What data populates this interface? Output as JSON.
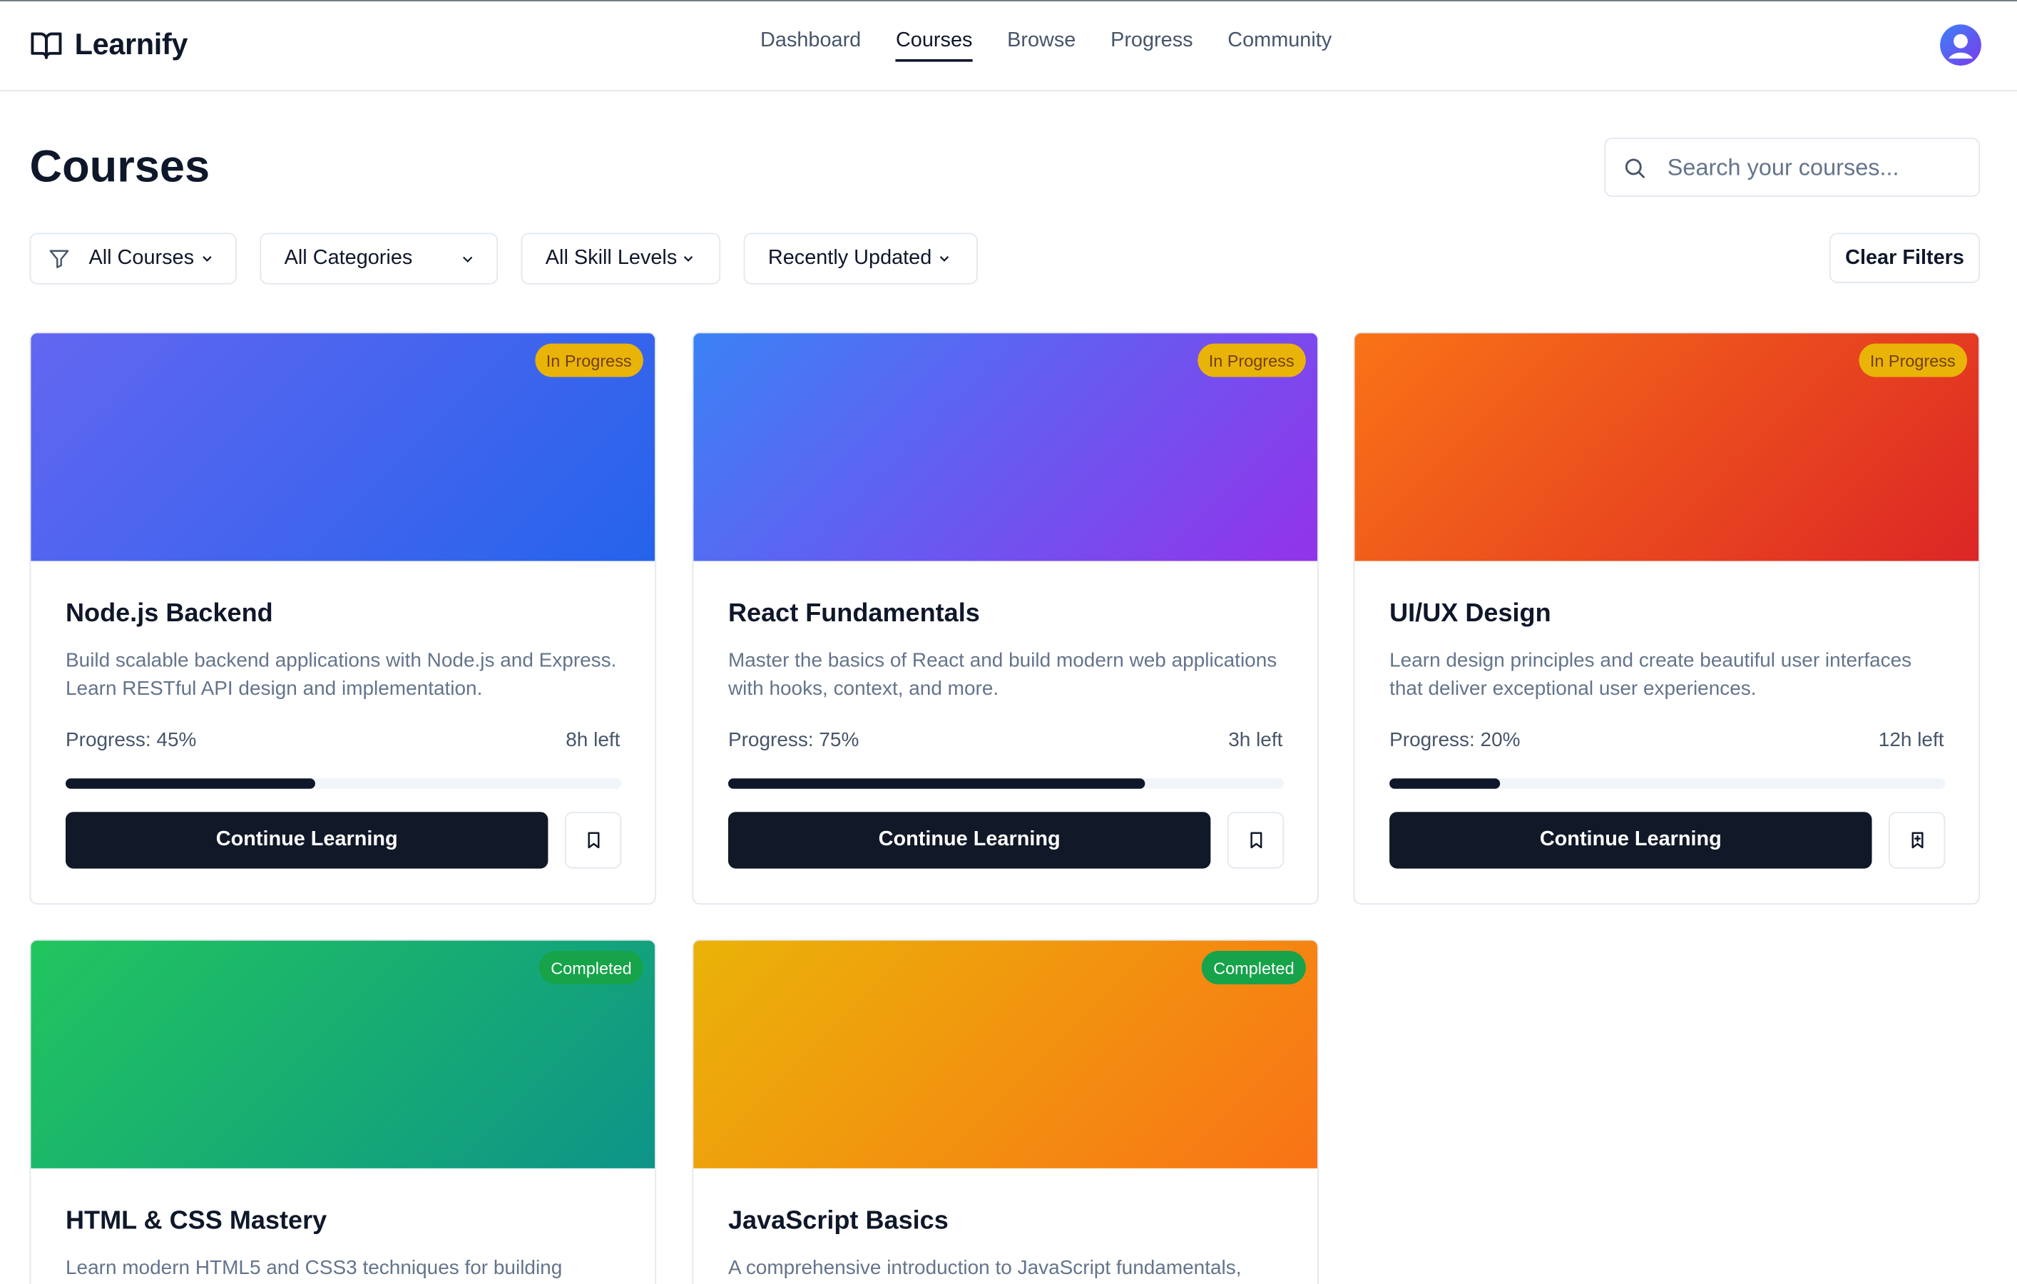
{
  "app": {
    "name": "Learnify"
  },
  "nav": {
    "items": [
      "Dashboard",
      "Courses",
      "Browse",
      "Progress",
      "Community"
    ],
    "active": "Courses"
  },
  "page": {
    "title": "Courses"
  },
  "search": {
    "placeholder": "Search your courses..."
  },
  "filters": {
    "status": "All Courses",
    "category": "All Categories",
    "skill": "All Skill Levels",
    "sort": "Recently Updated",
    "clear_label": "Clear Filters"
  },
  "continue_label": "Continue Learning",
  "courses": [
    {
      "title": "Node.js Backend",
      "description": "Build scalable backend applications with Node.js and Express. Learn RESTful API design and implementation.",
      "status": "In Progress",
      "progress_label": "Progress: 45%",
      "progress": 0.45,
      "time_left": "8h left",
      "gradient": [
        "#6366f1",
        "#2563eb"
      ]
    },
    {
      "title": "React Fundamentals",
      "description": "Master the basics of React and build modern web applications with hooks, context, and more.",
      "status": "In Progress",
      "progress_label": "Progress: 75%",
      "progress": 0.75,
      "time_left": "3h left",
      "gradient": [
        "#3b82f6",
        "#9333ea"
      ]
    },
    {
      "title": "UI/UX Design",
      "description": "Learn design principles and create beautiful user interfaces that deliver exceptional user experiences.",
      "status": "In Progress",
      "progress_label": "Progress: 20%",
      "progress": 0.2,
      "time_left": "12h left",
      "gradient": [
        "#f97316",
        "#dc2626"
      ]
    },
    {
      "title": "HTML & CSS Mastery",
      "description": "Learn modern HTML5 and CSS3 techniques for building",
      "status": "Completed",
      "gradient": [
        "#22c55e",
        "#0d9488"
      ]
    },
    {
      "title": "JavaScript Basics",
      "description": "A comprehensive introduction to JavaScript fundamentals,",
      "status": "Completed",
      "gradient": [
        "#eab308",
        "#f97316"
      ]
    }
  ]
}
